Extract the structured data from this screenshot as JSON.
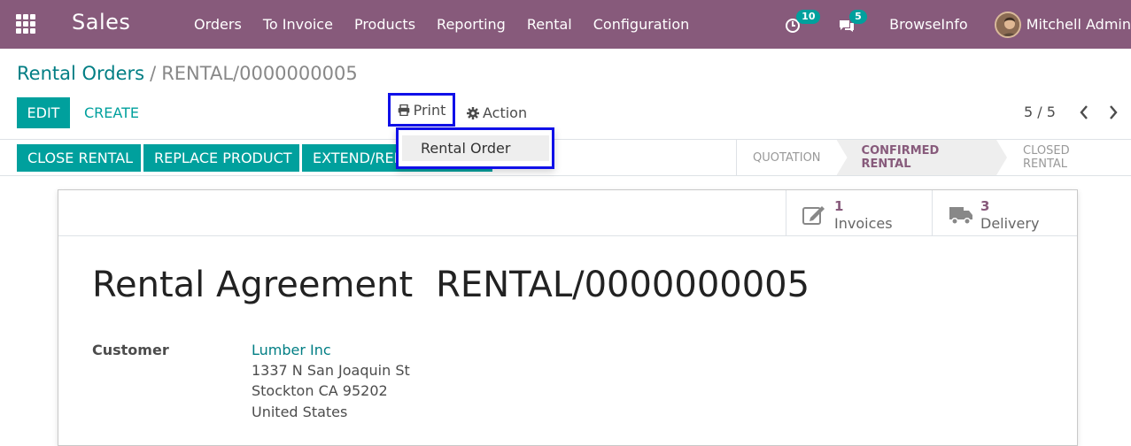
{
  "navbar": {
    "app_name": "Sales",
    "menu": [
      "Orders",
      "To Invoice",
      "Products",
      "Reporting",
      "Rental",
      "Configuration"
    ],
    "activity_count": "10",
    "message_count": "5",
    "company": "BrowseInfo",
    "user": "Mitchell Admin",
    "color": "#875a7b"
  },
  "breadcrumb": {
    "parent": "Rental Orders",
    "separator": "/",
    "current": "RENTAL/0000000005"
  },
  "buttons": {
    "edit": "EDIT",
    "create": "CREATE",
    "print": "Print",
    "action": "Action"
  },
  "pager": {
    "value": "5 / 5"
  },
  "dropdown": {
    "items": [
      "Rental Order"
    ]
  },
  "status_buttons": [
    "CLOSE RENTAL",
    "REPLACE PRODUCT",
    "EXTEND/RENEW RENTAL"
  ],
  "stages": [
    "QUOTATION",
    "CONFIRMED RENTAL",
    "CLOSED RENTAL"
  ],
  "active_stage": "CONFIRMED RENTAL",
  "smart_buttons": [
    {
      "count": "1",
      "label": "Invoices",
      "icon": "edit-icon"
    },
    {
      "count": "3",
      "label": "Delivery",
      "icon": "truck-icon"
    }
  ],
  "document": {
    "title": "Rental Agreement",
    "number": "RENTAL/0000000005",
    "customer_label": "Customer",
    "customer_name": "Lumber Inc",
    "address": [
      "1337 N San Joaquin St",
      "Stockton CA 95202",
      "United States"
    ]
  },
  "colors": {
    "accent": "#00a09d",
    "brand": "#875a7b",
    "highlight": "#1010e8"
  }
}
